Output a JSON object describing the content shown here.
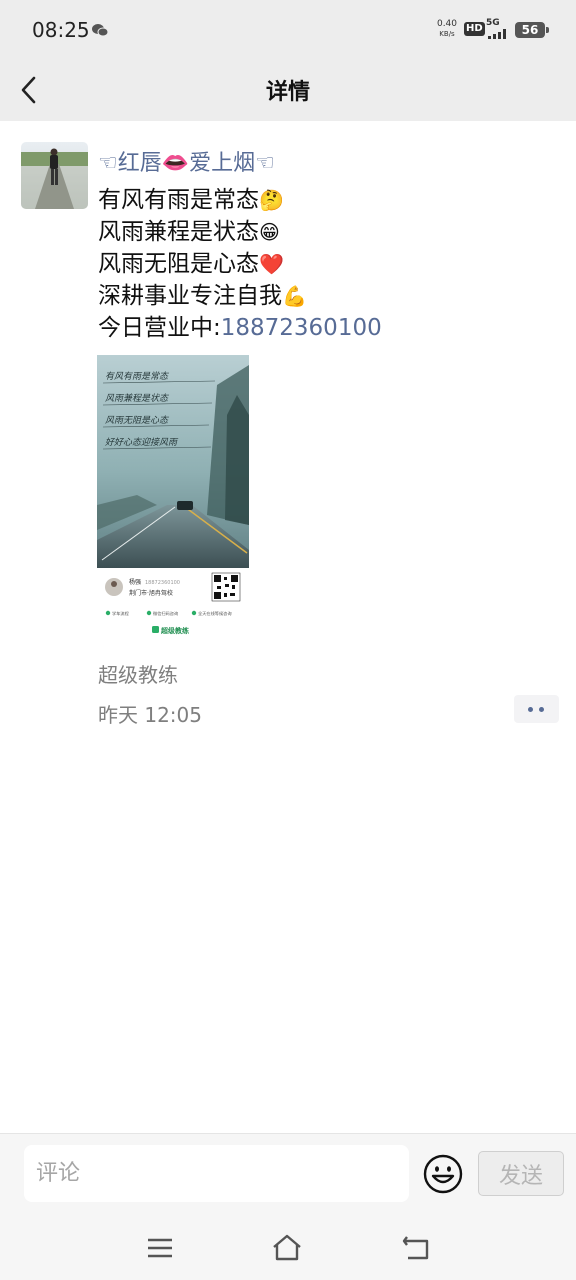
{
  "status_bar": {
    "time": "08:25",
    "net_speed_value": "0.40",
    "net_speed_unit": "KB/s",
    "hd": "HD",
    "network": "5G",
    "battery": "56"
  },
  "header": {
    "title": "详情",
    "back_icon": "chevron-left-icon"
  },
  "post": {
    "author": "☜红唇👄爱上烟☜",
    "lines": [
      {
        "text": "有风有雨是常态",
        "emoji": "🤔"
      },
      {
        "text": "风雨兼程是状态",
        "emoji": "😁"
      },
      {
        "text": "风雨无阻是心态",
        "emoji": "❤️"
      },
      {
        "text": "深耕事业专注自我",
        "emoji": "💪"
      }
    ],
    "last_line_prefix": "今日营业中:",
    "phone": "18872360100",
    "image": {
      "poem": [
        "有风有雨是常态",
        "风雨兼程是状态",
        "风雨无阻是心态",
        "好好心态迎接风雨"
      ],
      "card_name": "杨强",
      "card_phone": "18872360100",
      "card_school": "荆门市·旭冉驾校",
      "tags": [
        "学车流程",
        "微信扫码咨询",
        "全天在线等候咨询"
      ],
      "brand": "超级教练"
    },
    "source": "超级教练",
    "time": "昨天 12:05"
  },
  "comment_bar": {
    "placeholder": "评论",
    "send_label": "发送",
    "emoji_icon": "smiley-icon"
  },
  "system_nav": {
    "menu_icon": "menu-icon",
    "home_icon": "home-icon",
    "back_icon": "back-icon"
  }
}
